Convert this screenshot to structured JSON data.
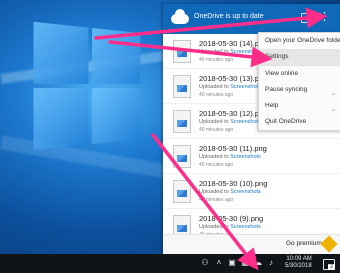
{
  "panel": {
    "status": "OneDrive is up to date",
    "files": [
      {
        "name": "2018-05-30 (14).png",
        "uploaded_prefix": "Uploaded to",
        "folder": "Screenshots",
        "time": "40 minutes ago"
      },
      {
        "name": "2018-05-30 (13).png",
        "uploaded_prefix": "Uploaded to",
        "folder": "Screenshots",
        "time": "40 minutes ago"
      },
      {
        "name": "2018-05-30 (12).png",
        "uploaded_prefix": "Uploaded to",
        "folder": "Screenshots",
        "time": "40 minutes ago"
      },
      {
        "name": "2018-05-30 (11).png",
        "uploaded_prefix": "Uploaded to",
        "folder": "Screenshots",
        "time": "40 minutes ago"
      },
      {
        "name": "2018-05-30 (10).png",
        "uploaded_prefix": "Uploaded to",
        "folder": "Screenshots",
        "time": "40 minutes ago"
      },
      {
        "name": "2018-05-30 (9).png",
        "uploaded_prefix": "Uploaded to",
        "folder": "Screenshots",
        "time": "40 minutes ago"
      }
    ],
    "premium_label": "Go premium"
  },
  "menu": {
    "items": [
      {
        "label": "Open your OneDrive folder"
      },
      {
        "label": "Settings"
      },
      {
        "label": "View online"
      },
      {
        "label": "Pause syncing"
      },
      {
        "label": "Help"
      },
      {
        "label": "Quit OneDrive"
      }
    ]
  },
  "taskbar": {
    "time": "10:09 AM",
    "date": "5/30/2018",
    "notification_count": "2"
  },
  "colors": {
    "onedrive_blue": "#0f68b8",
    "arrow_pink": "#ff2d8a",
    "link_blue": "#1a74c9"
  }
}
